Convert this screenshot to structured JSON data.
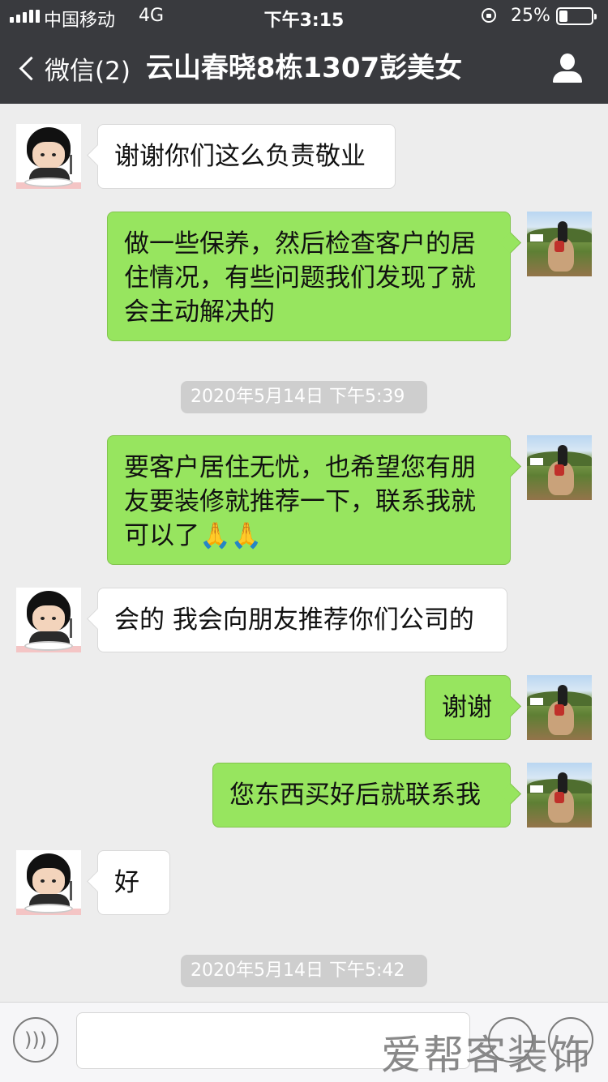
{
  "status_bar": {
    "carrier": "中国移动",
    "network": "4G",
    "time": "下午3:15",
    "battery_percent": "25%",
    "battery_level": 0.25
  },
  "nav": {
    "back_label": "微信(2)",
    "title": "云山春晓8栋1307彭美女",
    "back_icon": "chevron-left-icon",
    "profile_icon": "person-icon"
  },
  "messages": [
    {
      "from": "contact",
      "lines": [
        "谢谢你们这么负责敬业"
      ]
    },
    {
      "from": "me",
      "lines": [
        "做一些保养，然后检查客户的居",
        "住情况，有些问题我们发现了就",
        "会主动解决的"
      ]
    },
    {
      "type": "timestamp",
      "text": "2020年5月14日 下午5:39"
    },
    {
      "from": "me",
      "lines": [
        "要客户居住无忧，也希望您有朋",
        "友要装修就推荐一下，联系我就",
        "可以了🙏🙏"
      ]
    },
    {
      "from": "contact",
      "lines": [
        "会的 我会向朋友推荐你们公司的"
      ]
    },
    {
      "from": "me",
      "lines": [
        "谢谢"
      ]
    },
    {
      "from": "me",
      "lines": [
        "您东西买好后就联系我"
      ]
    },
    {
      "from": "contact",
      "lines": [
        "好"
      ]
    },
    {
      "type": "timestamp",
      "text": "2020年5月14日 下午5:42"
    }
  ],
  "input_bar": {
    "voice_icon": "voice-icon",
    "emoji_icon": "emoji-icon",
    "plus_icon": "plus-icon",
    "input_value": ""
  },
  "watermark": "爱帮客装饰",
  "colors": {
    "header_bg": "#393a3e",
    "chat_bg": "#ededed",
    "out_bubble": "#97e55f",
    "in_bubble": "#ffffff",
    "timestamp_bg": "#cecece"
  }
}
